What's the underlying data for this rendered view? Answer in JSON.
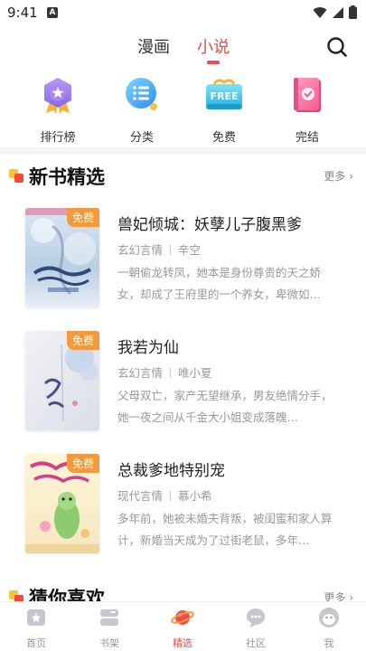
{
  "status_bar": {
    "time": "9:41",
    "indicator": "A"
  },
  "top_tabs": {
    "comic": "漫画",
    "novel": "小说",
    "active": "novel"
  },
  "categories": [
    {
      "label": "排行榜",
      "icon": "ranking-icon"
    },
    {
      "label": "分类",
      "icon": "category-list-icon"
    },
    {
      "label": "免费",
      "icon": "free-icon",
      "icon_text": "FREE"
    },
    {
      "label": "完结",
      "icon": "completed-book-icon"
    }
  ],
  "new_books": {
    "title": "新书精选",
    "more": "更多",
    "books": [
      {
        "badge": "免费",
        "title": "兽妃倾城：妖孽儿子腹黑爹",
        "genre": "玄幻言情",
        "author": "辛空",
        "desc": "一朝偷龙转凤，她本是身份尊贵的天之娇女，却成了王府里的一个养女，卑微如…"
      },
      {
        "badge": "免费",
        "title": "我若为仙",
        "genre": "玄幻言情",
        "author": "唯小夏",
        "desc": "父母双亡，家产无望继承，男友绝情分手，她一夜之间从千金大小姐变成落魄…"
      },
      {
        "badge": "免费",
        "title": "总裁爹地特别宠",
        "genre": "现代言情",
        "author": "慕小希",
        "desc": "多年前，她被未婚夫背叛，被闺蜜和家人算计，新婚当天成为了过街老鼠，多年…"
      }
    ]
  },
  "guess_you_like": {
    "title": "猜你喜欢",
    "more": "更多"
  },
  "bottom_nav": [
    {
      "label": "首页",
      "icon": "home-icon"
    },
    {
      "label": "书架",
      "icon": "bookshelf-icon"
    },
    {
      "label": "精选",
      "icon": "planet-icon",
      "active": true
    },
    {
      "label": "社区",
      "icon": "community-chat-icon"
    },
    {
      "label": "我",
      "icon": "profile-icon"
    }
  ],
  "colors": {
    "accent": "#ec4c4c",
    "badge": "#f29a3d",
    "nav_inactive": "#c6c6cc"
  }
}
